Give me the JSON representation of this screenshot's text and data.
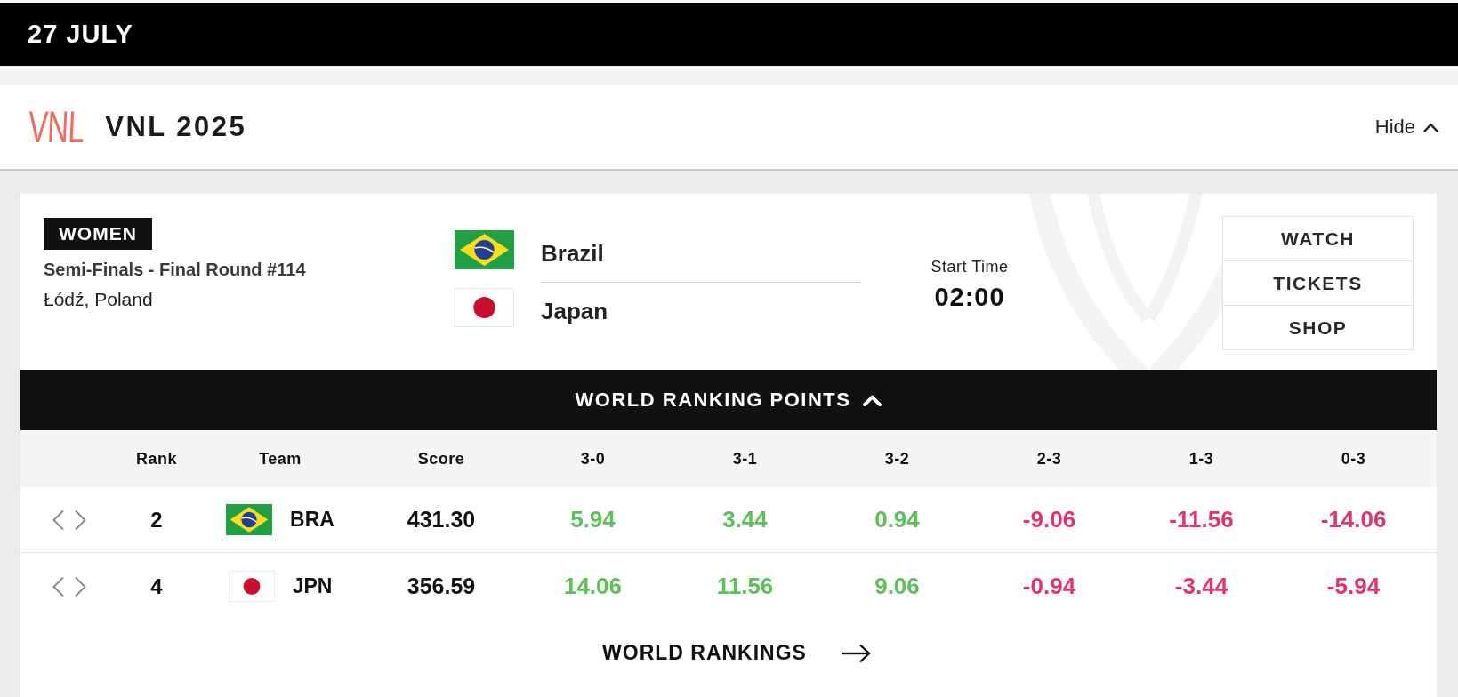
{
  "date_bar": {
    "label": "27 JULY"
  },
  "competition": {
    "logo": "VNL",
    "title": "VNL 2025",
    "toggle": {
      "label": "Hide",
      "expanded": true
    }
  },
  "match": {
    "category": "WOMEN",
    "phase": "Semi-Finals - Final Round #114",
    "venue": "Łódź, Poland",
    "teams": [
      {
        "name": "Brazil",
        "flag": {
          "kind": "brazil"
        }
      },
      {
        "name": "Japan",
        "flag": {
          "kind": "japan"
        }
      }
    ],
    "start_time": {
      "label": "Start Time",
      "value": "02:00"
    },
    "actions": [
      "WATCH",
      "TICKETS",
      "SHOP"
    ]
  },
  "ranking_points": {
    "toggle": {
      "label": "WORLD RANKING POINTS",
      "expanded": true
    },
    "columns": [
      "Rank",
      "Team",
      "Score",
      "3-0",
      "3-1",
      "3-2",
      "2-3",
      "1-3",
      "0-3"
    ],
    "rows": [
      {
        "rank": "2",
        "flag": {
          "kind": "brazil"
        },
        "team": "BRA",
        "score": "431.30",
        "points": [
          {
            "value": "5.94",
            "color": "#5cc157"
          },
          {
            "value": "3.44",
            "color": "#5cc157"
          },
          {
            "value": "0.94",
            "color": "#5cc157"
          },
          {
            "value": "-9.06",
            "color": "#e4336b"
          },
          {
            "value": "-11.56",
            "color": "#e4336b"
          },
          {
            "value": "-14.06",
            "color": "#e4336b"
          }
        ]
      },
      {
        "rank": "4",
        "flag": {
          "kind": "japan"
        },
        "team": "JPN",
        "score": "356.59",
        "points": [
          {
            "value": "14.06",
            "color": "#5cc157"
          },
          {
            "value": "11.56",
            "color": "#5cc157"
          },
          {
            "value": "9.06",
            "color": "#5cc157"
          },
          {
            "value": "-0.94",
            "color": "#e4336b"
          },
          {
            "value": "-3.44",
            "color": "#e4336b"
          },
          {
            "value": "-5.94",
            "color": "#e4336b"
          }
        ]
      }
    ]
  },
  "world_rankings_link": {
    "label": "WORLD RANKINGS"
  }
}
